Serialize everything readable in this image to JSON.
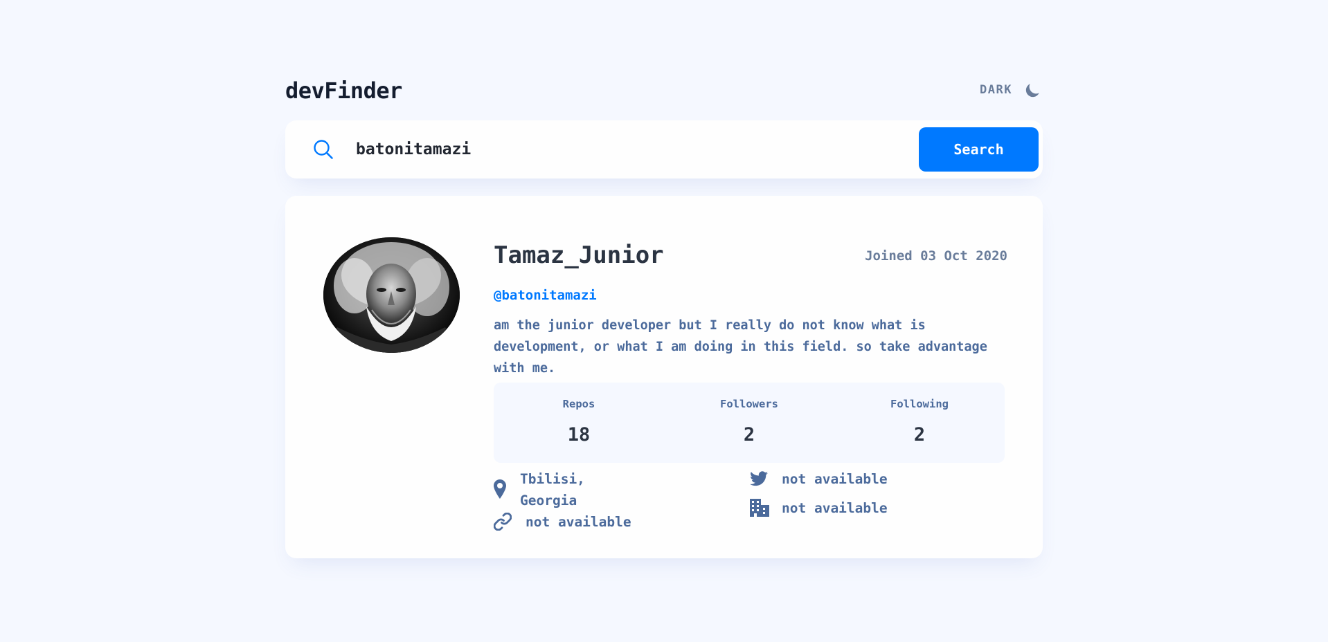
{
  "header": {
    "logo": "devFinder",
    "theme_label": "DARK",
    "theme_icon": "moon-icon"
  },
  "search": {
    "value": "batonitamazi",
    "placeholder": "",
    "button_label": "Search",
    "icon": "search-icon"
  },
  "profile": {
    "name": "Tamaz_Junior",
    "joined": "Joined 03 Oct 2020",
    "login": "@batonitamazi",
    "bio": "am the junior developer but I really do not know what is development, or what I am doing in this field. so take advantage with me.",
    "stats": [
      {
        "label": "Repos",
        "value": "18"
      },
      {
        "label": "Followers",
        "value": "2"
      },
      {
        "label": "Following",
        "value": "2"
      }
    ],
    "links": {
      "location": {
        "icon": "location-pin-icon",
        "line1": "Tbilisi,",
        "line2": "Georgia"
      },
      "blog": {
        "icon": "link-icon",
        "text": "not available"
      },
      "twitter": {
        "icon": "twitter-icon",
        "text": "not available"
      },
      "company": {
        "icon": "building-icon",
        "text": "not available"
      }
    }
  },
  "colors": {
    "background": "#f5f8ff",
    "accent": "#0079ff",
    "text_dark": "#2b3442",
    "text_muted": "#4b6a9b",
    "card": "#fefefe"
  }
}
